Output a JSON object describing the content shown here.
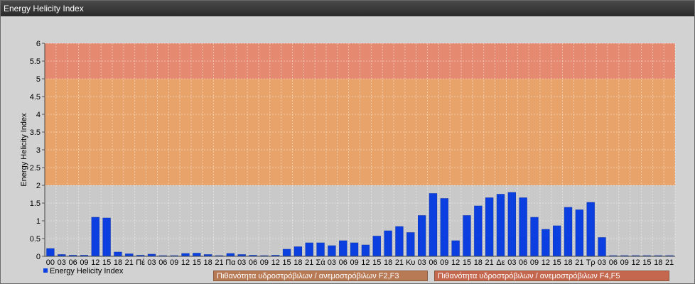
{
  "window": {
    "title": "Energy Helicity Index"
  },
  "legend": {
    "series_label": "Energy Helicity Index"
  },
  "bands": [
    {
      "label": "Πιθανότητα υδροστρόβιλων / ανεμοστρόβιλων F2,F3",
      "from": 2,
      "to": 5,
      "color": "#e8a36a"
    },
    {
      "label": "Πιθανότητα υδροστρόβιλων / ανεμοστρόβιλων F4,F5",
      "from": 5,
      "to": 6,
      "color": "#e58a70"
    }
  ],
  "chart_data": {
    "type": "bar",
    "ylabel": "Energy Helicity Index",
    "ylim": [
      0,
      6
    ],
    "yticks": [
      "0",
      "0.5",
      "1",
      "1.5",
      "2",
      "2.5",
      "3",
      "3.5",
      "4",
      "4.5",
      "5",
      "5.5",
      "6"
    ],
    "grid": true,
    "categories": [
      "00",
      "03",
      "06",
      "09",
      "12",
      "15",
      "18",
      "21",
      "Πέ",
      "03",
      "06",
      "09",
      "12",
      "15",
      "18",
      "21",
      "Πα",
      "03",
      "06",
      "09",
      "12",
      "15",
      "18",
      "21",
      "Σά",
      "03",
      "06",
      "09",
      "12",
      "15",
      "18",
      "21",
      "Κυ",
      "03",
      "06",
      "09",
      "12",
      "15",
      "18",
      "21",
      "Δε",
      "03",
      "06",
      "09",
      "12",
      "15",
      "18",
      "21",
      "Τρ",
      "03",
      "06",
      "09",
      "12",
      "15",
      "18",
      "21"
    ],
    "series": [
      {
        "name": "Energy Helicity Index",
        "color": "#0b3fe0",
        "values": [
          0.22,
          0.05,
          0.03,
          0.03,
          1.1,
          1.08,
          0.12,
          0.07,
          0.03,
          0.06,
          0.02,
          0.02,
          0.08,
          0.09,
          0.05,
          0.02,
          0.08,
          0.05,
          0.03,
          0.02,
          0.03,
          0.2,
          0.27,
          0.38,
          0.38,
          0.3,
          0.44,
          0.38,
          0.32,
          0.57,
          0.72,
          0.84,
          0.67,
          1.15,
          1.77,
          1.63,
          0.44,
          1.15,
          1.42,
          1.65,
          1.75,
          1.8,
          1.65,
          1.1,
          0.76,
          0.86,
          1.38,
          1.31,
          1.52,
          0.53,
          0.02,
          0.02,
          0.02,
          0.02,
          0.02,
          0.02
        ]
      }
    ]
  }
}
